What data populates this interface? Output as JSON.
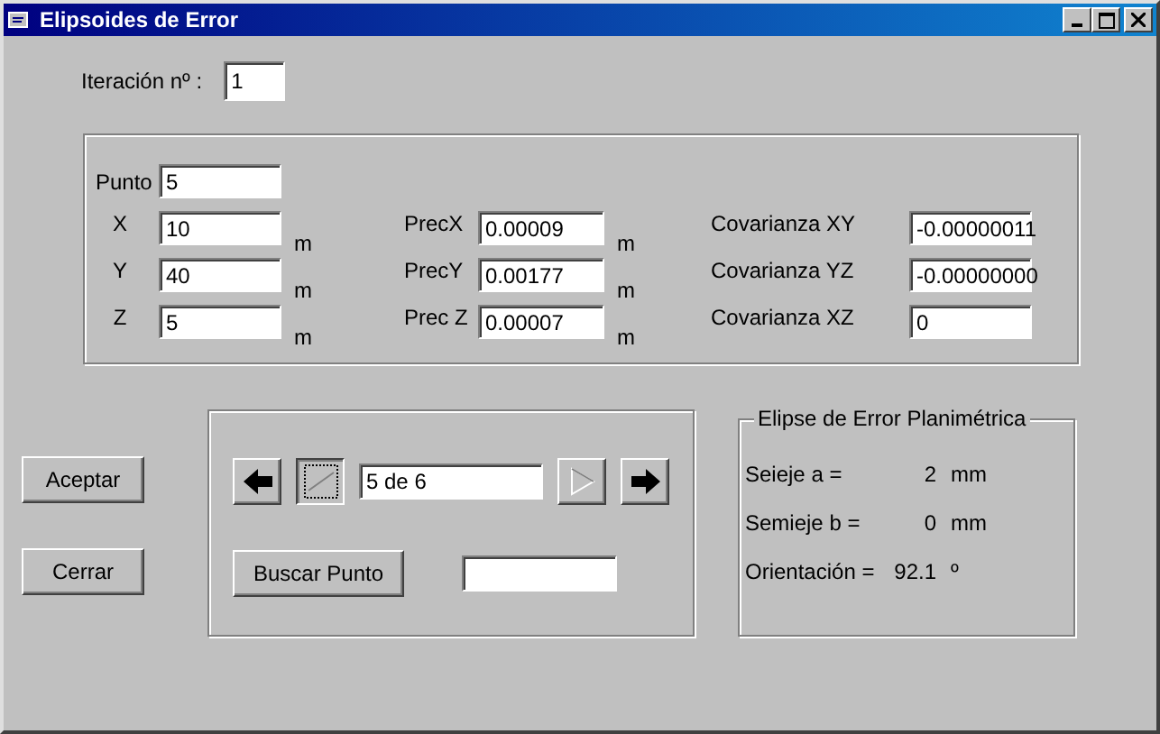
{
  "window": {
    "title": "Elipsoides de Error"
  },
  "iteration": {
    "label": "Iteración nº :",
    "value": "1"
  },
  "punto": {
    "label": "Punto",
    "value": "5"
  },
  "coordinates": [
    {
      "label": "X",
      "value": "10",
      "unit": "m",
      "prec_label": "PrecX",
      "prec_value": "0.00009",
      "prec_unit": "m",
      "cov_label": "Covarianza XY",
      "cov_value": "-0.00000011"
    },
    {
      "label": "Y",
      "value": "40",
      "unit": "m",
      "prec_label": "PrecY",
      "prec_value": "0.00177",
      "prec_unit": "m",
      "cov_label": "Covarianza YZ",
      "cov_value": "-0.00000000"
    },
    {
      "label": "Z",
      "value": "5",
      "unit": "m",
      "prec_label": "Prec Z",
      "prec_value": "0.00007",
      "prec_unit": "m",
      "cov_label": "Covarianza XZ",
      "cov_value": "0"
    }
  ],
  "buttons": [
    "Aceptar",
    "Cerrar"
  ],
  "navigator": {
    "buttons": [
      {
        "kind": "previous",
        "disabled": false
      },
      {
        "kind": "edit",
        "disabled": false
      },
      {
        "kind": "play",
        "disabled": true
      },
      {
        "kind": "next",
        "disabled": false
      }
    ],
    "position": "5 de 6",
    "search_button": "Buscar Punto"
  },
  "ellipse": {
    "title": "Elipse de Error Planimétrica",
    "rows": [
      {
        "label": "Seieje a =",
        "value": "2",
        "unit": "mm"
      },
      {
        "label": "Semieje b =",
        "value": "0",
        "unit": "mm"
      },
      {
        "label": "Orientación =",
        "value": "92.1",
        "unit": "º"
      }
    ]
  }
}
